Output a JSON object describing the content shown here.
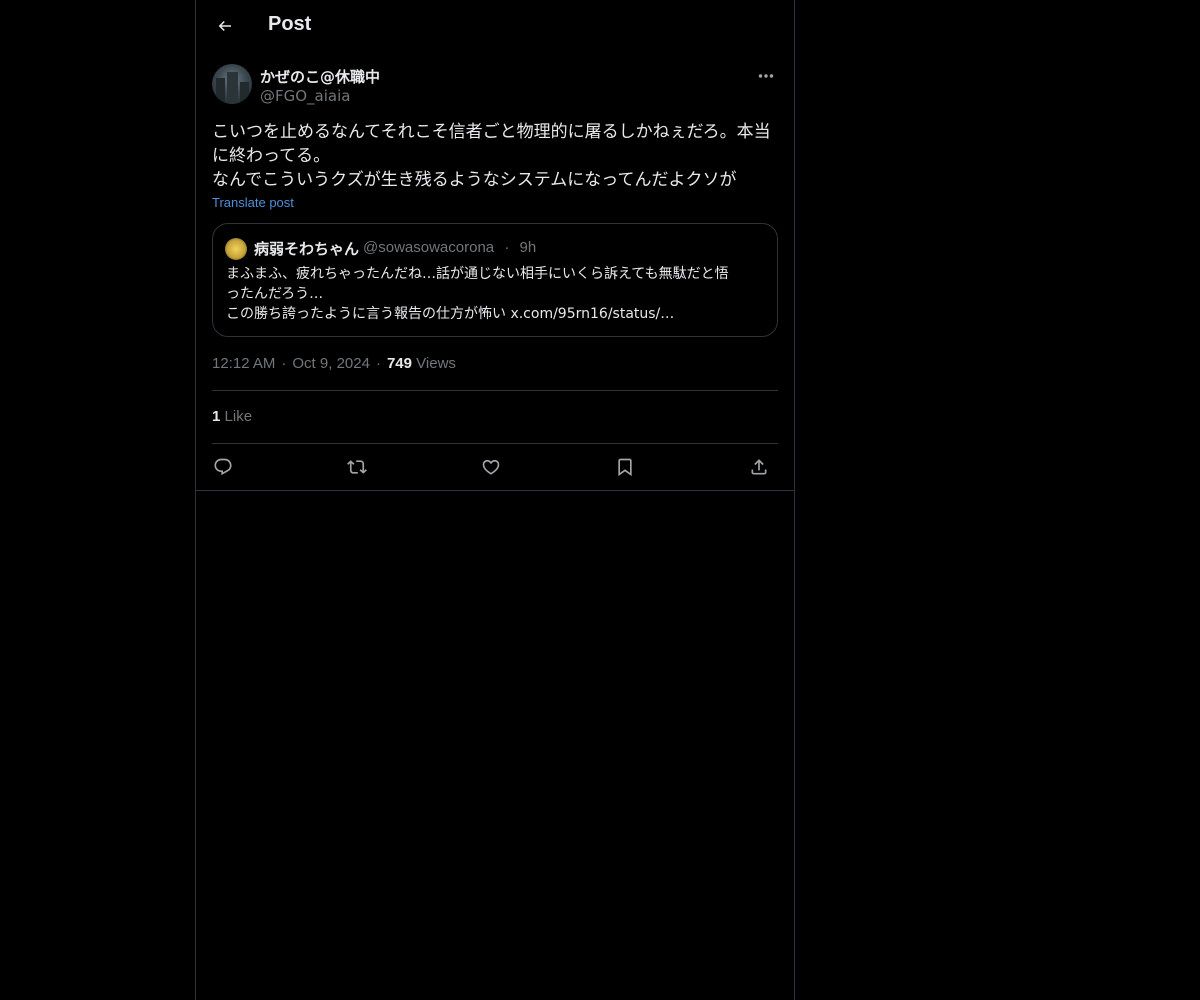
{
  "header": {
    "title": "Post"
  },
  "author": {
    "display_name": "かぜのこ@休職中",
    "handle": "@FGO_aiaia"
  },
  "post": {
    "text_lines": [
      "こいつを止めるなんてそれこそ信者ごと物理的に屠るしかねぇだろ。本当",
      "に終わってる。",
      "なんでこういうクズが生き残るようなシステムになってんだよクソが"
    ],
    "translate_label": "Translate post"
  },
  "quote": {
    "display_name": "病弱そわちゃん",
    "handle": "@sowasowacorona",
    "separator": "·",
    "time": "9h",
    "text_lines": [
      "まふまふ、疲れちゃったんだね…話が通じない相手にいくら訴えても無駄だと悟",
      "ったんだろう…",
      "この勝ち誇ったように言う報告の仕方が怖い x.com/95rn16/status/…"
    ]
  },
  "meta": {
    "time": "12:12 AM",
    "separator": "·",
    "date": "Oct 9, 2024",
    "views_count": "749",
    "views_label": "Views"
  },
  "engagement": {
    "likes_count": "1",
    "likes_label": "Like"
  },
  "icons": {
    "back": "arrow-left-icon",
    "more": "more-horizontal-icon",
    "reply": "reply-icon",
    "repost": "repost-icon",
    "like": "heart-icon",
    "bookmark": "bookmark-icon",
    "share": "share-icon"
  },
  "colors": {
    "background": "#000000",
    "text": "#e7e9ea",
    "secondary_text": "#71767b",
    "border": "#2f3336",
    "link": "#4d8fd9"
  }
}
